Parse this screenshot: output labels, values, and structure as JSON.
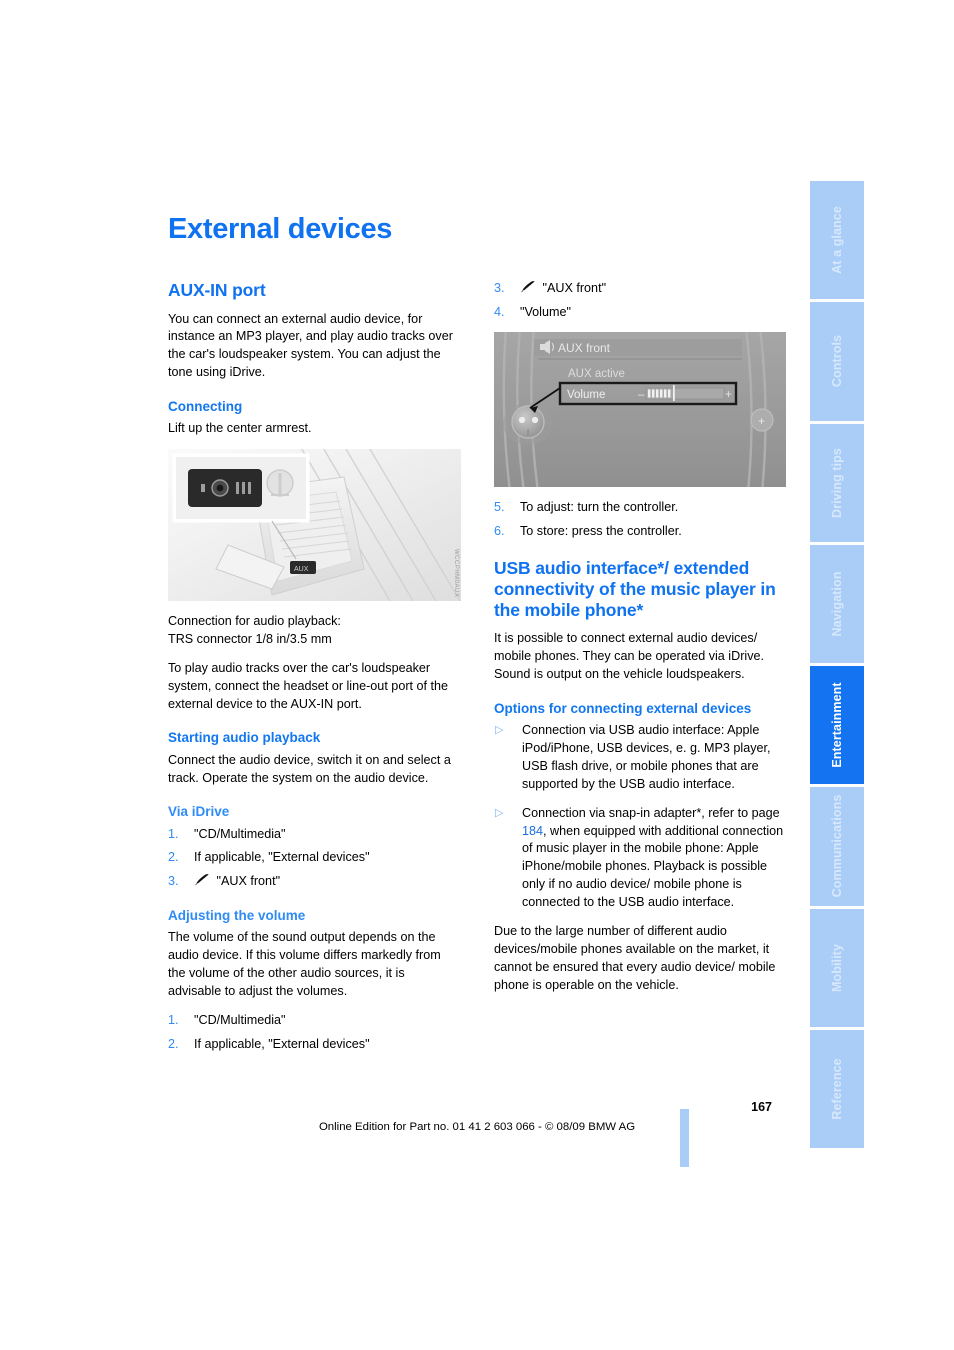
{
  "document": {
    "chapter_title": "External devices",
    "page_number": "167",
    "footer_line": "Online Edition for Part no. 01 41 2 603 066 - © 08/09 BMW AG"
  },
  "sidebar": {
    "tabs": [
      {
        "label": "At a glance",
        "active": false
      },
      {
        "label": "Controls",
        "active": false
      },
      {
        "label": "Driving tips",
        "active": false
      },
      {
        "label": "Navigation",
        "active": false
      },
      {
        "label": "Entertainment",
        "active": true
      },
      {
        "label": "Communications",
        "active": false
      },
      {
        "label": "Mobility",
        "active": false
      },
      {
        "label": "Reference",
        "active": false
      }
    ]
  },
  "left_column": {
    "aux_heading": "AUX-IN port",
    "aux_intro": "You can connect an external audio device, for instance an MP3 player, and play audio tracks over the car's loudspeaker system. You can adjust the tone using iDrive.",
    "connecting_heading": "Connecting",
    "connecting_text": "Lift up the center armrest.",
    "console_figure": {
      "alt": "Center console with AUX-IN port and armrest lifted",
      "code": "WCCPHM0AUX"
    },
    "caption_line1": "Connection for audio playback:",
    "caption_line2": "TRS connector 1/8 in/3.5 mm",
    "caption_para": "To play audio tracks over the car's loudspeaker system, connect the headset or line-out port of the external device to the AUX-IN port.",
    "starting_heading": "Starting audio playback",
    "starting_text": "Connect the audio device, switch it on and select a track. Operate the system on the audio device.",
    "via_idrive_heading": "Via iDrive",
    "via_idrive_steps": [
      {
        "num": "1.",
        "text": "\"CD/Multimedia\"",
        "icon": ""
      },
      {
        "num": "2.",
        "text": "If applicable, \"External devices\"",
        "icon": ""
      },
      {
        "num": "3.",
        "text": "\"AUX front\"",
        "icon": "pen-icon"
      }
    ],
    "volume_heading": "Adjusting the volume",
    "volume_text": "The volume of the sound output depends on the audio device. If this volume differs markedly from the volume of the other audio sources, it is advisable to adjust the volumes.",
    "volume_steps": [
      {
        "num": "1.",
        "text": "\"CD/Multimedia\"",
        "icon": ""
      },
      {
        "num": "2.",
        "text": "If applicable, \"External devices\"",
        "icon": ""
      }
    ]
  },
  "right_column": {
    "volume_steps_cont": [
      {
        "num": "3.",
        "text": "\"AUX front\"",
        "icon": "pen-icon"
      },
      {
        "num": "4.",
        "text": "\"Volume\"",
        "icon": ""
      }
    ],
    "idrive_figure": {
      "alt": "iDrive display showing AUX front menu with volume slider",
      "title": "AUX front",
      "status": "AUX active",
      "slider_label": "Volume",
      "minus": "–",
      "plus": "+"
    },
    "steps_after_figure": [
      {
        "num": "5.",
        "text": "To adjust: turn the controller.",
        "icon": ""
      },
      {
        "num": "6.",
        "text": "To store: press the controller.",
        "icon": ""
      }
    ],
    "usb_heading": "USB audio interface*/ extended connectivity of the music player in the mobile phone*",
    "usb_intro": "It is possible to connect external audio devices/ mobile phones. They can be operated via iDrive. Sound is output on the vehicle loudspeakers.",
    "options_heading": "Options for connecting external devices",
    "bullets": [
      {
        "marker": "▷",
        "text": "Connection via USB audio interface: Apple iPod/iPhone, USB devices, e. g. MP3 player, USB flash drive, or mobile phones that are supported by the USB audio interface."
      },
      {
        "marker": "▷",
        "text_before": "Connection via snap-in adapter*, refer to page ",
        "page_ref": "184",
        "text_after": ", when equipped with additional connection of music player in the mobile phone: Apple iPhone/mobile phones. Playback is possible only if no audio device/ mobile phone is connected to the USB audio interface."
      }
    ],
    "closing_para": "Due to the large number of different audio devices/mobile phones available on the market, it cannot be ensured that every audio device/ mobile phone is operable on the vehicle."
  },
  "colors": {
    "heading_blue": "#0f72f0",
    "sub_blue": "#2f8bf5",
    "tab_inactive": "#aacdf7",
    "tab_active": "#1473f0",
    "page_ref": "#1a6fe0"
  }
}
